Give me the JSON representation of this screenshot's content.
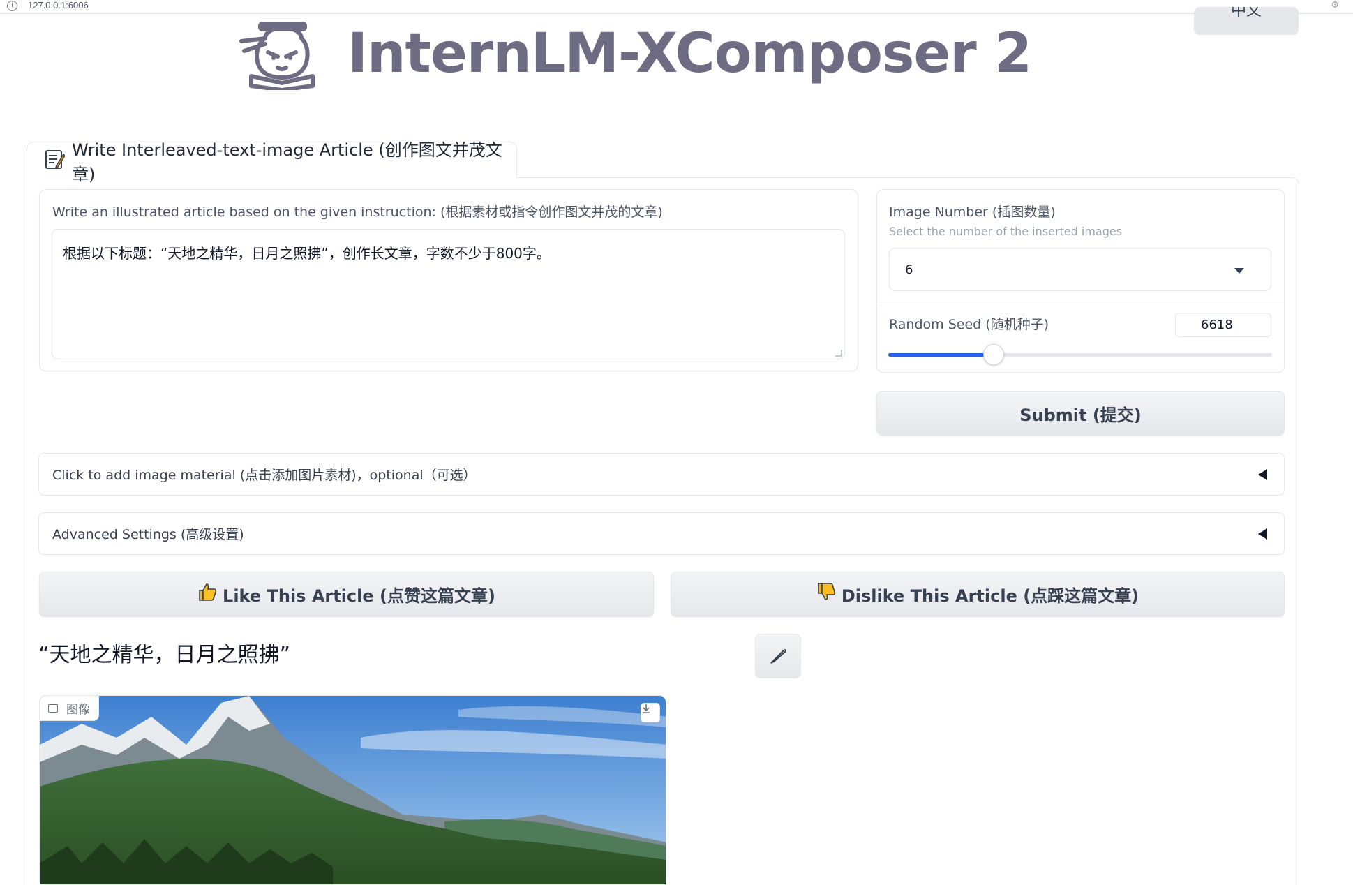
{
  "browser": {
    "url": "127.0.0.1:6006"
  },
  "header": {
    "lang_button_label": "中文",
    "title": "InternLM-XComposer 2"
  },
  "tab": {
    "icon": "memo-icon",
    "label": "Write Interleaved-text-image Article (创作图文并茂文章)"
  },
  "instruction": {
    "label": "Write an illustrated article based on the given instruction: (根据素材或指令创作图文并茂的文章)",
    "value": "根据以下标题：“天地之精华，日月之照拂”，创作长文章，字数不少于800字。"
  },
  "image_number": {
    "label": "Image Number (插图数量)",
    "info": "Select the number of the inserted images",
    "selected": "6"
  },
  "random_seed": {
    "label": "Random Seed (随机种子)",
    "value": "6618",
    "slider_fraction": 0.275
  },
  "submit_label": "Submit (提交)",
  "accordions": {
    "image_material": "Click to add image material (点击添加图片素材)，optional（可选）",
    "advanced": "Advanced Settings (高级设置)"
  },
  "feedback": {
    "like_label": "Like This Article (点赞这篇文章)",
    "dislike_label": "Dislike This Article (点踩这篇文章)"
  },
  "article": {
    "title": "“天地之精华，日月之照拂”",
    "image_tag": "图像"
  },
  "colors": {
    "accent": "#2563eb",
    "title_gray": "#6e6c83",
    "border": "#e5e7eb"
  }
}
